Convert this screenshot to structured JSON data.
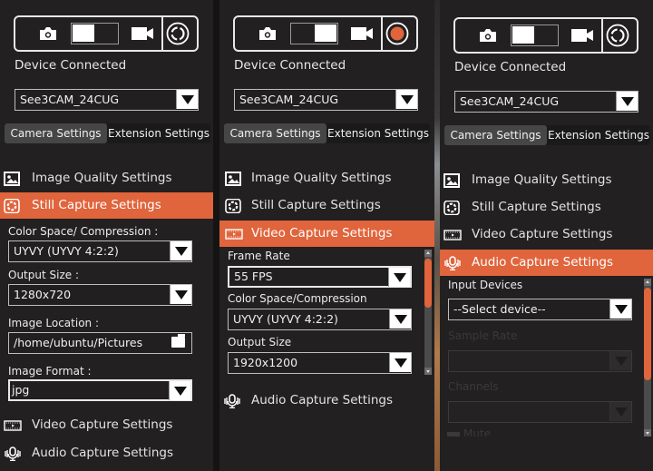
{
  "panels": [
    {
      "mode_toggle": {
        "selected": "still-capture",
        "action_icon": "capture-rotate-icon"
      },
      "device_status": "Device Connected",
      "device_select": "See3CAM_24CUG",
      "tabs": [
        {
          "label": "Camera Settings",
          "active": true
        },
        {
          "label": "Extension Settings",
          "active": false
        }
      ],
      "menu": [
        {
          "label": "Image Quality Settings",
          "icon": "image-icon",
          "active": false
        },
        {
          "label": "Still Capture Settings",
          "icon": "aperture-icon",
          "active": true
        },
        {
          "label": "Video Capture Settings",
          "icon": "film-icon",
          "active": false
        },
        {
          "label": "Audio Capture Settings",
          "icon": "microphone-icon",
          "active": false
        }
      ],
      "fields": {
        "color_space_label": "Color Space/ Compression :",
        "color_space_value": "UYVY (UYVY 4:2:2)",
        "output_size_label": "Output Size :",
        "output_size_value": "1280x720",
        "image_location_label": "Image Location :",
        "image_location_value": "/home/ubuntu/Pictures",
        "image_format_label": "Image Format :",
        "image_format_value": "jpg"
      }
    },
    {
      "mode_toggle": {
        "selected": "video-capture",
        "action_icon": "record-icon",
        "record_color": "#e0643c"
      },
      "device_status": "Device Connected",
      "device_select": "See3CAM_24CUG",
      "tabs": [
        {
          "label": "Camera Settings",
          "active": true
        },
        {
          "label": "Extension Settings",
          "active": false
        }
      ],
      "menu": [
        {
          "label": "Image Quality Settings",
          "icon": "image-icon",
          "active": false
        },
        {
          "label": "Still Capture Settings",
          "icon": "aperture-icon",
          "active": false
        },
        {
          "label": "Video Capture Settings",
          "icon": "film-icon",
          "active": true
        },
        {
          "label": "Audio Capture Settings",
          "icon": "microphone-icon",
          "active": false
        }
      ],
      "fields": {
        "frame_rate_label": "Frame Rate",
        "frame_rate_value": "55 FPS",
        "color_space_label": "Color Space/Compression",
        "color_space_value": "UYVY (UYVY 4:2:2)",
        "output_size_label": "Output Size",
        "output_size_value": "1920x1200"
      }
    },
    {
      "mode_toggle": {
        "selected": "still-capture",
        "action_icon": "capture-rotate-icon"
      },
      "device_status": "Device Connected",
      "device_select": "See3CAM_24CUG",
      "tabs": [
        {
          "label": "Camera Settings",
          "active": true
        },
        {
          "label": "Extension Settings",
          "active": false
        }
      ],
      "menu": [
        {
          "label": "Image Quality Settings",
          "icon": "image-icon",
          "active": false
        },
        {
          "label": "Still Capture Settings",
          "icon": "aperture-icon",
          "active": false
        },
        {
          "label": "Video Capture Settings",
          "icon": "film-icon",
          "active": false
        },
        {
          "label": "Audio Capture Settings",
          "icon": "microphone-icon",
          "active": true
        }
      ],
      "fields": {
        "input_devices_label": "Input Devices",
        "input_devices_value": "--Select device--",
        "sample_rate_label": "Sample Rate",
        "channels_label": "Channels",
        "mute_label": "Mute"
      }
    }
  ],
  "colors": {
    "accent": "#e0643c",
    "panel_bg": "#222021",
    "text": "#e6e6e6"
  }
}
